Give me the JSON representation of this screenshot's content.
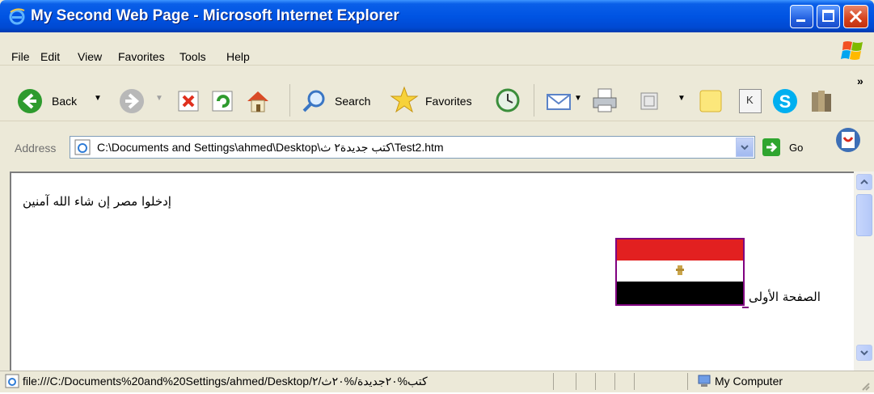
{
  "window": {
    "title": "My Second Web Page - Microsoft Internet Explorer"
  },
  "menu": {
    "items": [
      {
        "label": "File"
      },
      {
        "label": "Edit"
      },
      {
        "label": "View"
      },
      {
        "label": "Favorites"
      },
      {
        "label": "Tools"
      },
      {
        "label": "Help"
      }
    ]
  },
  "toolbar": {
    "back_label": "Back",
    "search_label": "Search",
    "favorites_label": "Favorites",
    "overflow": "»",
    "k_label": "K"
  },
  "address": {
    "label": "Address",
    "value": "C:\\Documents and Settings\\ahmed\\Desktop\\كتب جديدة٢ ث\\Test2.htm",
    "go_label": "Go"
  },
  "page": {
    "paragraph": "إدخلوا مصر إن شاء الله آمنين",
    "link_text": "الصفحة الأولى"
  },
  "status": {
    "url": "file:///C:/Documents%20and%20Settings/ahmed/Desktop/كتب%٢٠جديدة/%٢٠ث/٢",
    "zone": "My Computer"
  },
  "colors": {
    "titlebar": "#0054E3",
    "chrome": "#ECE9D8",
    "flag_red": "#E22020",
    "flag_black": "#000000",
    "visited_link": "#800080"
  }
}
